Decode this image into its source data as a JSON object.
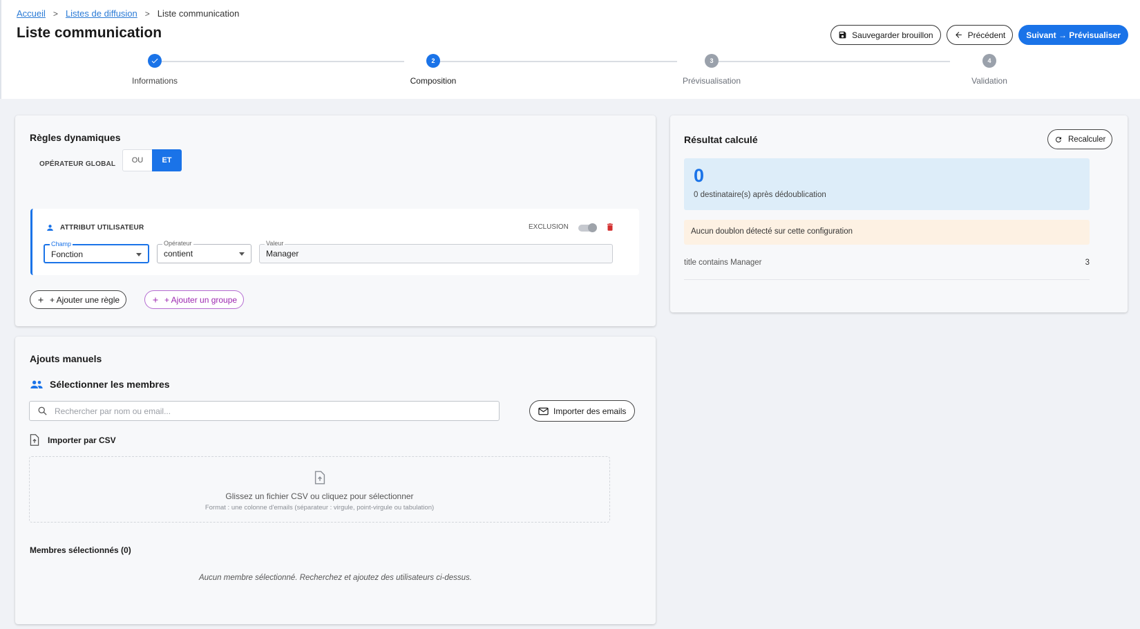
{
  "breadcrumb": {
    "home": "Accueil",
    "lists": "Listes de diffusion",
    "current": "Liste communication"
  },
  "page_title": "Liste communication",
  "actions": {
    "save_draft": "Sauvegarder brouillon",
    "previous": "Précédent",
    "next": "Suivant → Prévisualiser"
  },
  "steps": [
    {
      "number": "1",
      "label": "Informations",
      "status": "done"
    },
    {
      "number": "2",
      "label": "Composition",
      "status": "active"
    },
    {
      "number": "3",
      "label": "Prévisualisation",
      "status": "pending"
    },
    {
      "number": "4",
      "label": "Validation",
      "status": "pending"
    }
  ],
  "dynamic_rules": {
    "title": "Règles dynamiques",
    "global_operator_label": "OPÉRATEUR GLOBAL",
    "operator_options": [
      "OU",
      "ET"
    ],
    "operator_selected": "ET",
    "rule": {
      "type_label": "ATTRIBUT UTILISATEUR",
      "exclusion_label": "EXCLUSION",
      "exclusion_on": false,
      "field_label": "Champ",
      "field_value": "Fonction",
      "operator_label": "Opérateur",
      "operator_value": "contient",
      "value_label": "Valeur",
      "value_value": "Manager"
    },
    "add_rule": "+ Ajouter une règle",
    "add_group": "+ Ajouter un groupe"
  },
  "manual": {
    "title": "Ajouts manuels",
    "select_members": "Sélectionner les membres",
    "search_placeholder": "Rechercher par nom ou email...",
    "import_emails": "Importer des emails",
    "csv_title": "Importer par CSV",
    "dropzone_main": "Glissez un fichier CSV ou cliquez pour sélectionner",
    "dropzone_sub": "Format : une colonne d'emails (séparateur : virgule, point-virgule ou tabulation)",
    "selected_members": "Membres sélectionnés (0)",
    "empty_message": "Aucun membre sélectionné. Recherchez et ajoutez des utilisateurs ci-dessus."
  },
  "result": {
    "title": "Résultat calculé",
    "recalc": "Recalculer",
    "count": "0",
    "count_caption": "0 destinataire(s) après dédoublication",
    "warning": "Aucun doublon détecté sur cette configuration",
    "rules": [
      {
        "label": "title contains Manager",
        "count": "3"
      }
    ]
  },
  "colors": {
    "primary": "#1a73e8",
    "purple": "#9c27b0",
    "danger": "#d32f2f",
    "result_bg": "#ddedf9",
    "warning_bg": "#fdf1e3"
  }
}
